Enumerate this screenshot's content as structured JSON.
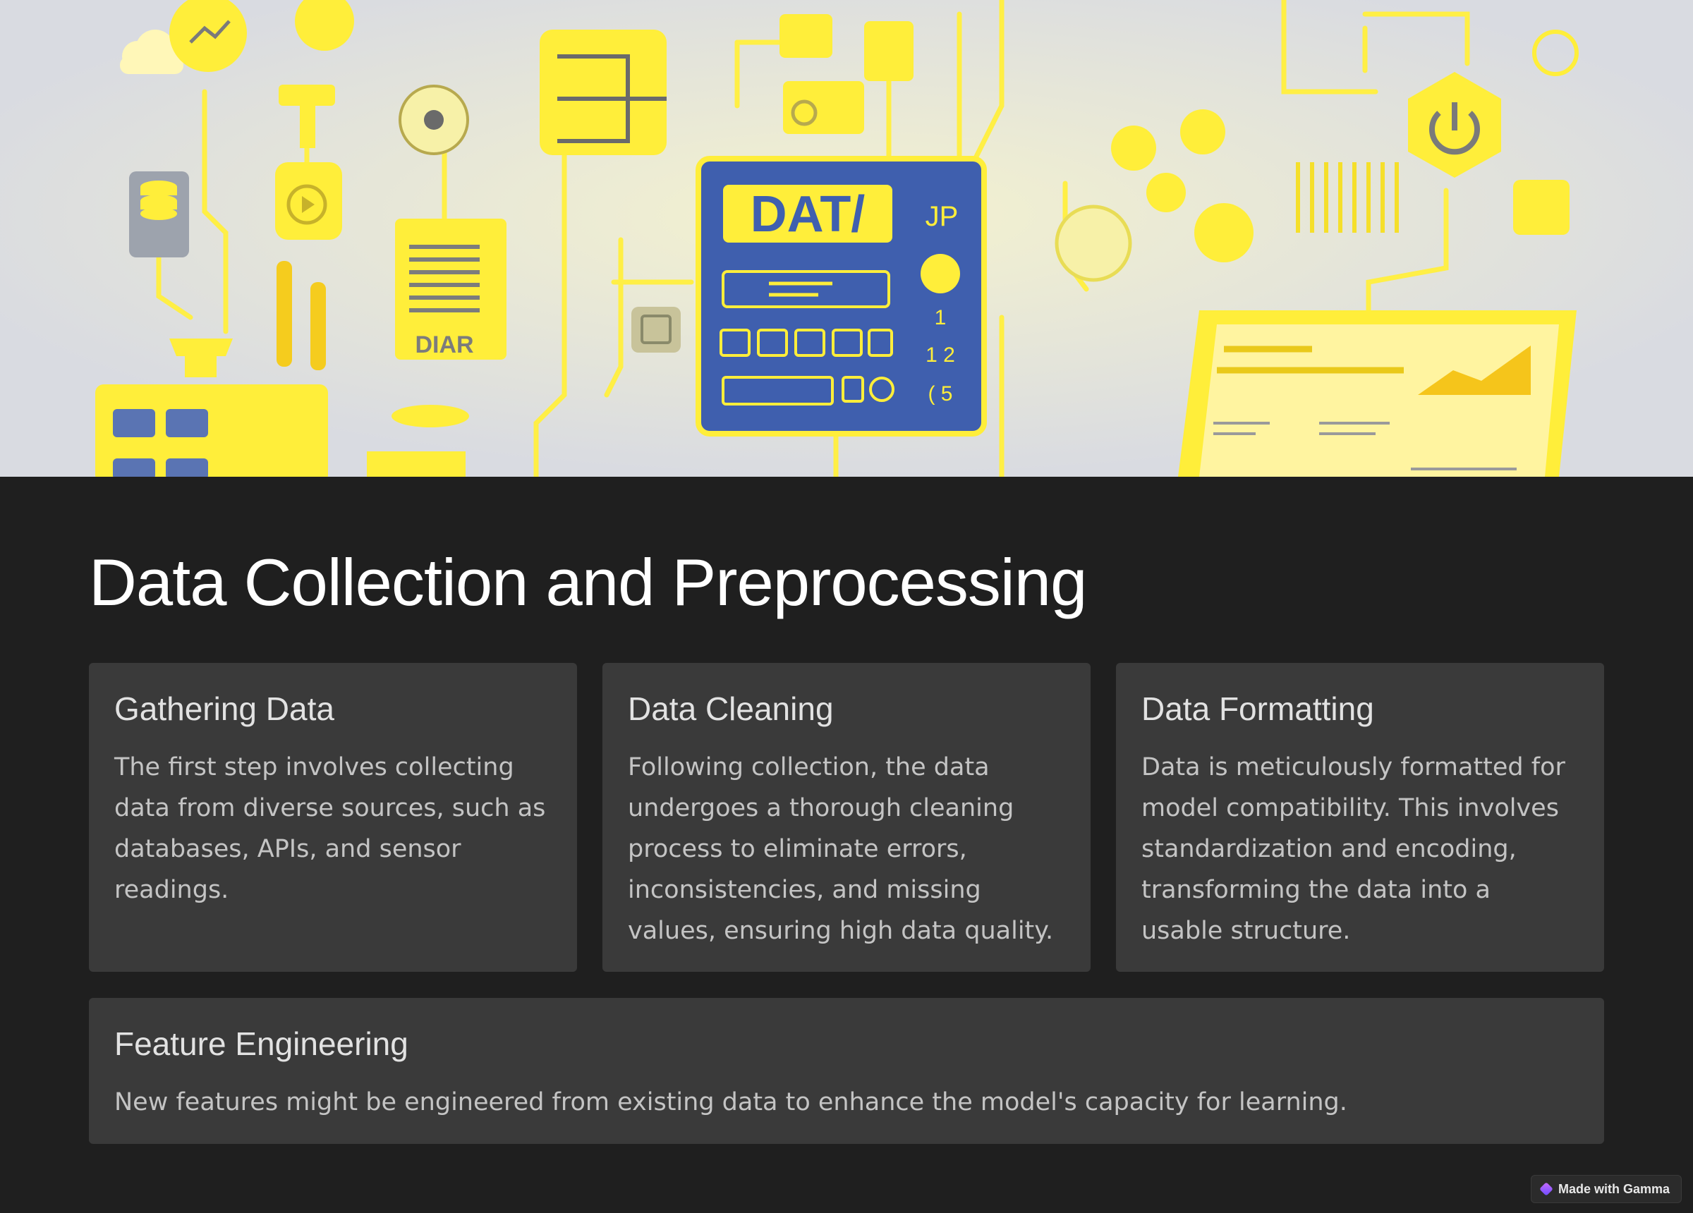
{
  "hero": {
    "panel_title": "DAT/",
    "panel_side": "JP",
    "panel_numbers": [
      "1",
      "1 2",
      "( 5"
    ],
    "left_label": "DIAR",
    "colors": {
      "yellow": "#ffee3a",
      "blue": "#3f5fae",
      "background": "#dcdee3"
    }
  },
  "page": {
    "title": "Data Collection and Preprocessing"
  },
  "cards": [
    {
      "title": "Gathering Data",
      "body": "The first step involves collecting data from diverse sources, such as databases, APIs, and sensor readings."
    },
    {
      "title": "Data Cleaning",
      "body": "Following collection, the data undergoes a thorough cleaning process to eliminate errors, inconsistencies, and missing values, ensuring high data quality."
    },
    {
      "title": "Data Formatting",
      "body": "Data is meticulously formatted for model compatibility. This involves standardization and encoding, transforming the data into a usable structure."
    }
  ],
  "wide_card": {
    "title": "Feature Engineering",
    "body": "New features might be engineered from existing data to enhance the model's capacity for learning."
  },
  "badge": {
    "label": "Made with Gamma",
    "icon": "gamma-icon"
  }
}
